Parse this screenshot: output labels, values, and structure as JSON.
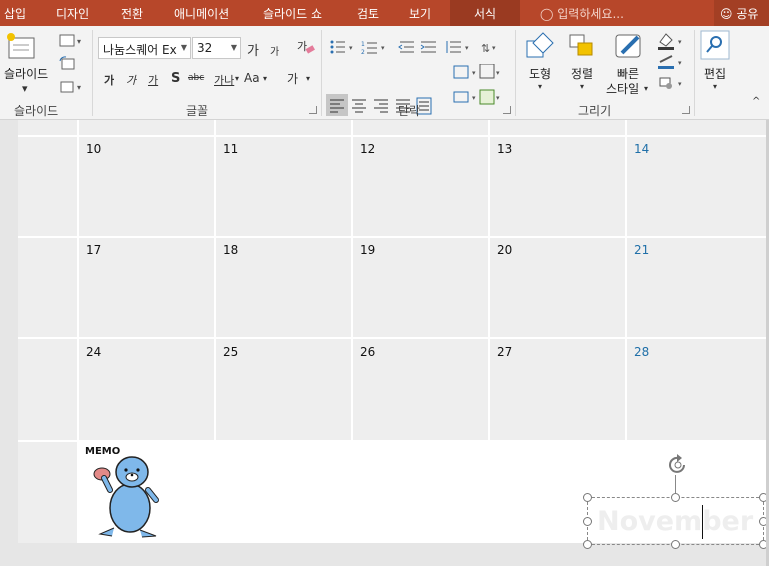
{
  "menu": {
    "tabs": [
      "삽입",
      "디자인",
      "전환",
      "애니메이션",
      "슬라이드 쇼",
      "검토",
      "보기",
      "서식"
    ],
    "search_placeholder": "입력하세요...",
    "share": "공유"
  },
  "ribbon": {
    "slides": {
      "new_slide": "슬라이드",
      "label": "슬라이드"
    },
    "font": {
      "name": "나눔스퀘어 Ex",
      "size": "32",
      "label": "글꼴",
      "bold": "가",
      "italic": "가",
      "underline": "가",
      "shadow": "S",
      "strike": "abc",
      "spacing": "가나",
      "case": "Aa",
      "grow": "가",
      "shrink": "가",
      "color": "가"
    },
    "paragraph": {
      "label": "단락"
    },
    "drawing": {
      "shapes": "도형",
      "arrange": "정렬",
      "quick_styles_1": "빠른",
      "quick_styles_2": "스타일",
      "label": "그리기"
    },
    "editing": {
      "edit": "편집"
    }
  },
  "calendar": {
    "rows": [
      [
        "10",
        "11",
        "12",
        "13",
        "14"
      ],
      [
        "17",
        "18",
        "19",
        "20",
        "21"
      ],
      [
        "24",
        "25",
        "26",
        "27",
        "28"
      ]
    ],
    "memo": "MEMO"
  },
  "textbox": {
    "ghost_text": "November"
  },
  "colors": {
    "accent": "#b7472a",
    "weekend": "#1f6fa8"
  }
}
